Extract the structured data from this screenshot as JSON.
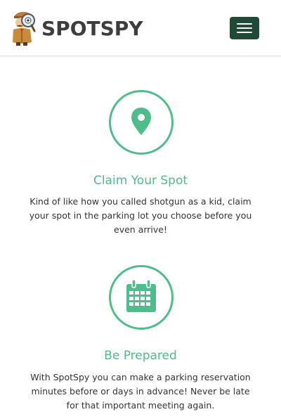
{
  "header": {
    "brand": "SPOTSPY",
    "logo_icon": "detective-mascot-icon",
    "menu_icon": "hamburger-menu-icon"
  },
  "colors": {
    "accent": "#4ebd8c",
    "menu_button": "#1f4a35",
    "brand_text": "#3d3d3d",
    "body_text": "#333333"
  },
  "features": [
    {
      "icon": "map-pin-icon",
      "title": "Claim Your Spot",
      "text": "Kind of like how you called shotgun as a kid, claim your spot in the parking lot you choose before you even arrive!"
    },
    {
      "icon": "calendar-icon",
      "title": "Be Prepared",
      "text": "With SpotSpy you can make a parking reservation minutes before or days in advance! Never be late for that important meeting again."
    }
  ]
}
